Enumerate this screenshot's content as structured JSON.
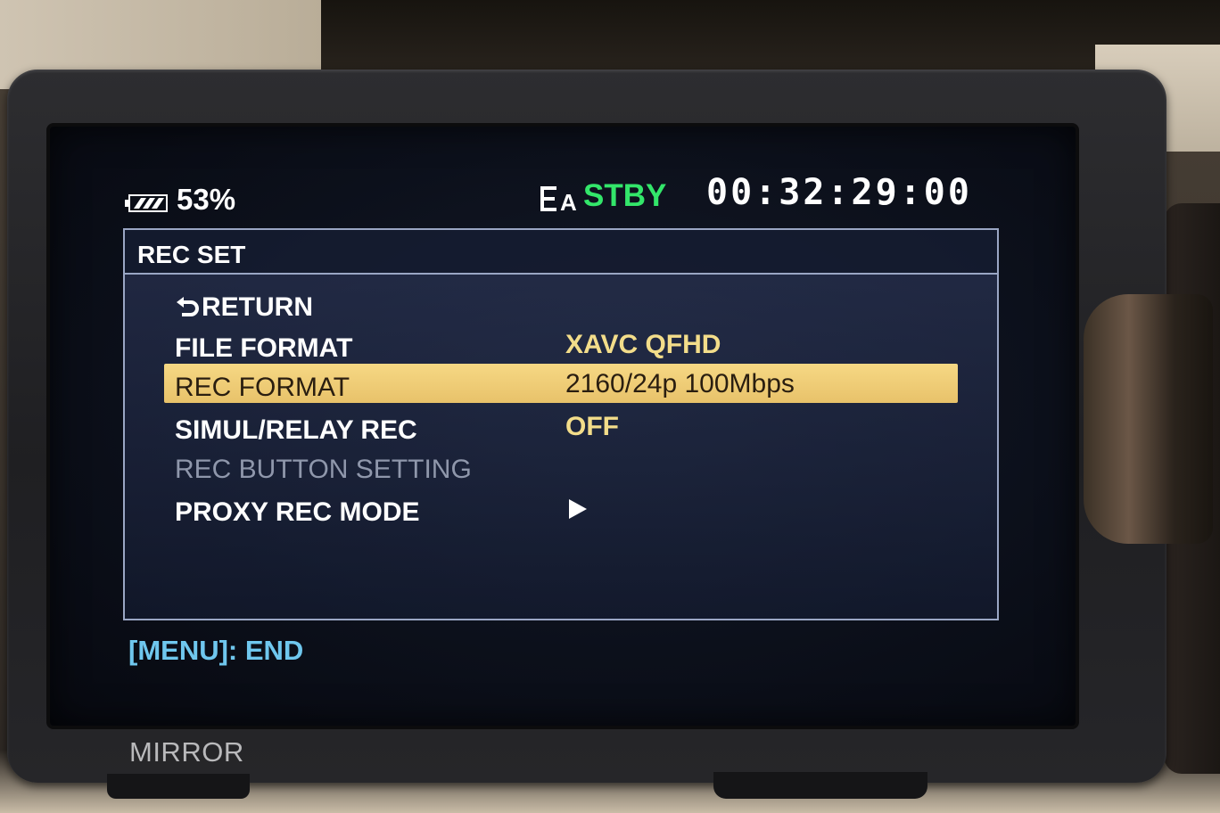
{
  "status_bar": {
    "battery": "53%",
    "media_slot": "A",
    "rec_state": "STBY",
    "timecode": "00:32:29:00",
    "rec_state_color": "#33e66a"
  },
  "menu": {
    "title": "REC SET",
    "items": [
      {
        "label": "RETURN",
        "value": "",
        "icon": "return-arrow-icon",
        "enabled": true
      },
      {
        "label": "FILE FORMAT",
        "value": "XAVC QFHD",
        "enabled": true
      },
      {
        "label": "REC FORMAT",
        "value": "2160/24p 100Mbps",
        "enabled": true,
        "selected": true
      },
      {
        "label": "SIMUL/RELAY REC",
        "value": "OFF",
        "enabled": true
      },
      {
        "label": "REC BUTTON SETTING",
        "value": "",
        "enabled": false
      },
      {
        "label": "PROXY REC MODE",
        "value": "",
        "icon": "submenu-arrow-icon",
        "enabled": true
      }
    ],
    "highlight_color": "#f0cf78"
  },
  "footer": {
    "hint": "[MENU]: END"
  },
  "camera": {
    "mirror_label": "MIRROR"
  }
}
